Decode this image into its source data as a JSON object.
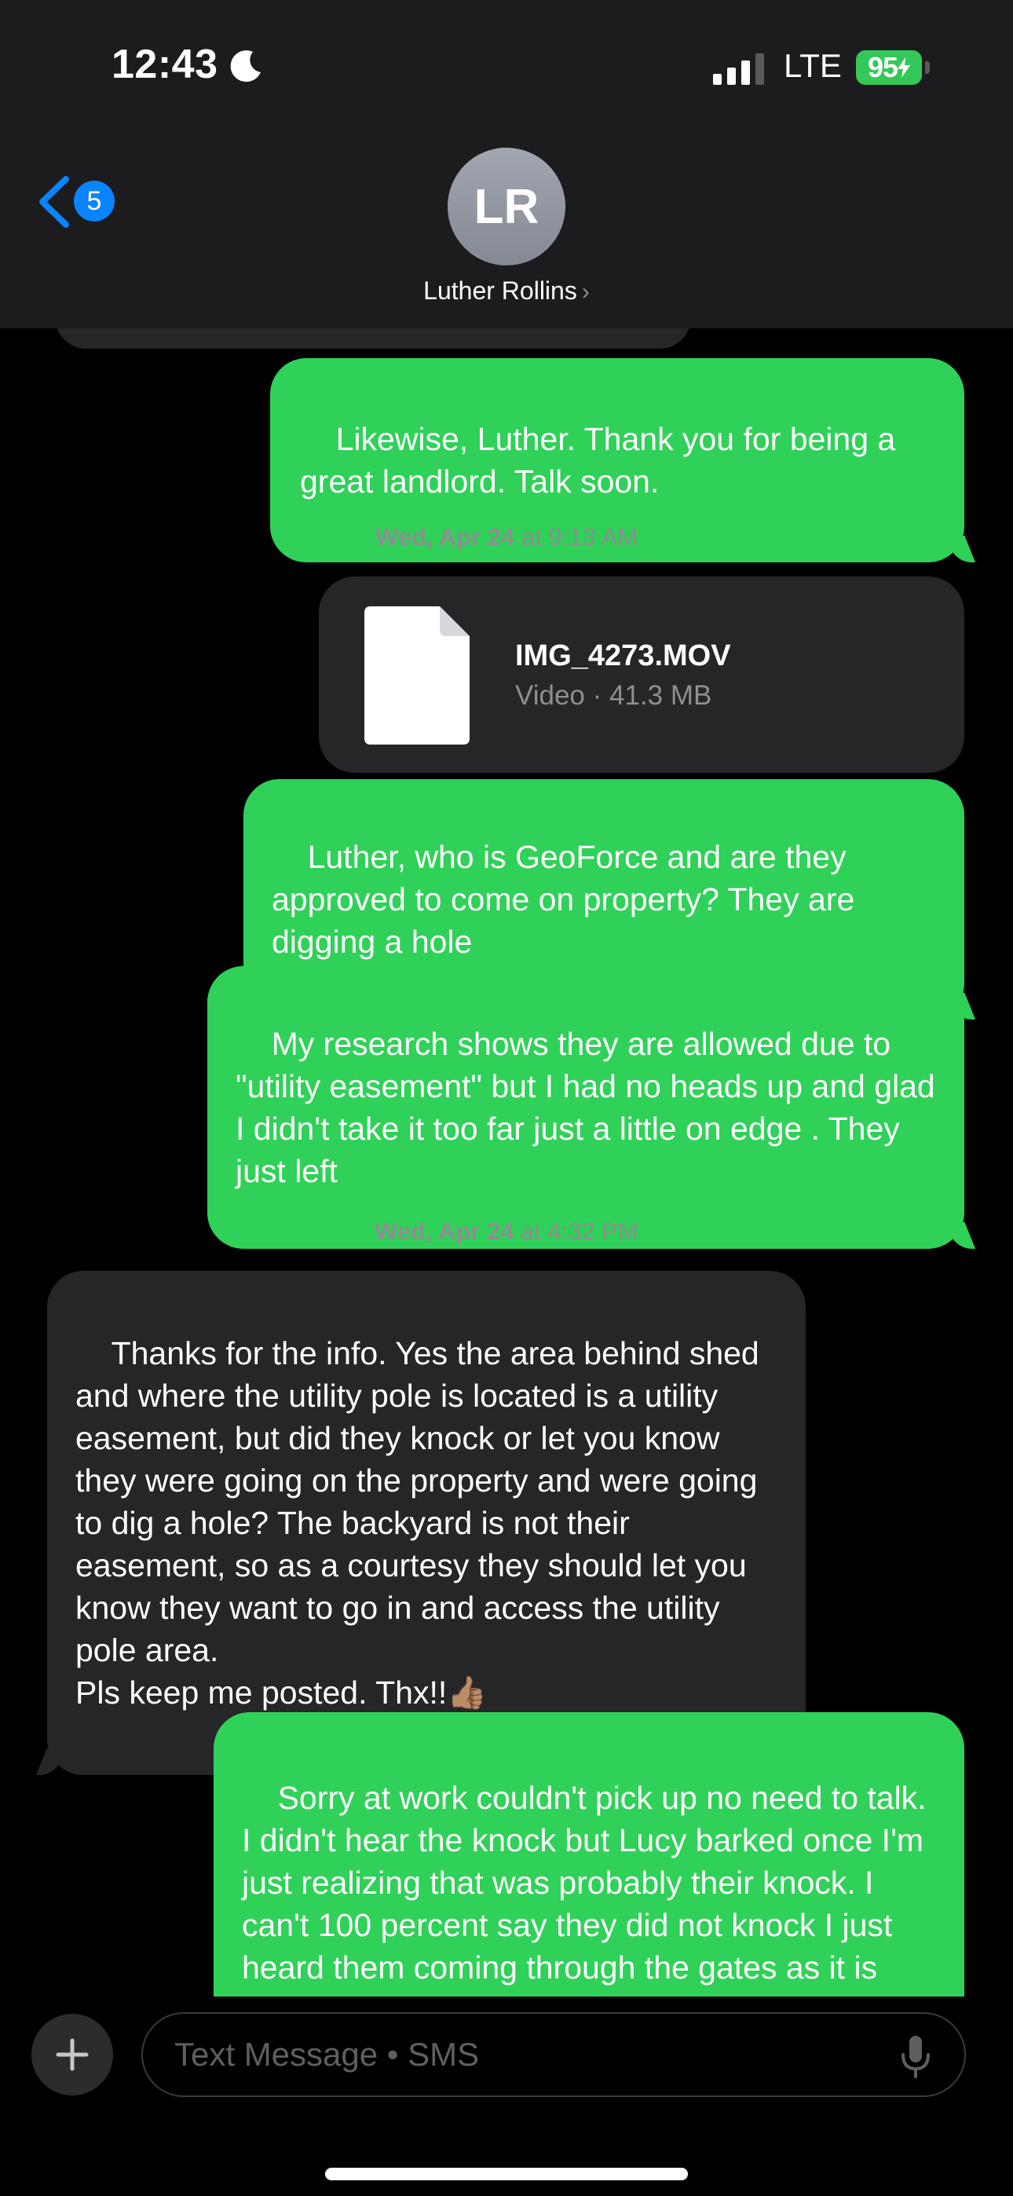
{
  "status_bar": {
    "time": "12:43",
    "network": "LTE",
    "battery": "95"
  },
  "header": {
    "back_count": "5",
    "avatar_initials": "LR",
    "contact_name": "Luther Rollins",
    "name_chevron": "›"
  },
  "messages": [
    {
      "type": "sent",
      "text": "Likewise, Luther. Thank you for being a great landlord. Talk soon."
    },
    {
      "type": "timestamp",
      "day": "Wed, Apr 24",
      "at": " at ",
      "time": "9:13 AM"
    },
    {
      "type": "attachment",
      "file_name": "IMG_4273.MOV",
      "meta": "Video · 41.3 MB",
      "icon": "document-icon"
    },
    {
      "type": "sent",
      "text": "Luther, who is GeoForce and are they approved to come on property? They are digging a hole"
    },
    {
      "type": "sent",
      "text": "My research shows they are allowed due to \"utility easement\" but I had no heads up and glad I didn't take it too far just a little on edge . They just left"
    },
    {
      "type": "timestamp",
      "day": "Wed, Apr 24",
      "at": " at ",
      "time": "4:32 PM"
    },
    {
      "type": "received",
      "text": "Thanks for the info. Yes the area behind shed and where the utility pole is located is a utility easement, but did they knock or let you know they were going on the property and were going to dig a hole? The backyard is not their easement, so as a courtesy they should let you know they want to go in and access the utility pole area.\nPls keep me posted. Thx!!👍🏽"
    },
    {
      "type": "sent",
      "text": "Sorry at work couldn't pick up no need to talk. I didn't hear the knock but Lucy barked once I'm just realizing that was probably their knock. I can't 100 percent say they did not knock I just heard them coming through the gates as it is next to the back room where my desk is. The"
    }
  ],
  "composer": {
    "placeholder": "Text Message • SMS"
  },
  "colors": {
    "sent_bubble": "#30d158",
    "received_bubble": "#262629",
    "accent": "#0a84ff",
    "battery": "#34c759"
  }
}
